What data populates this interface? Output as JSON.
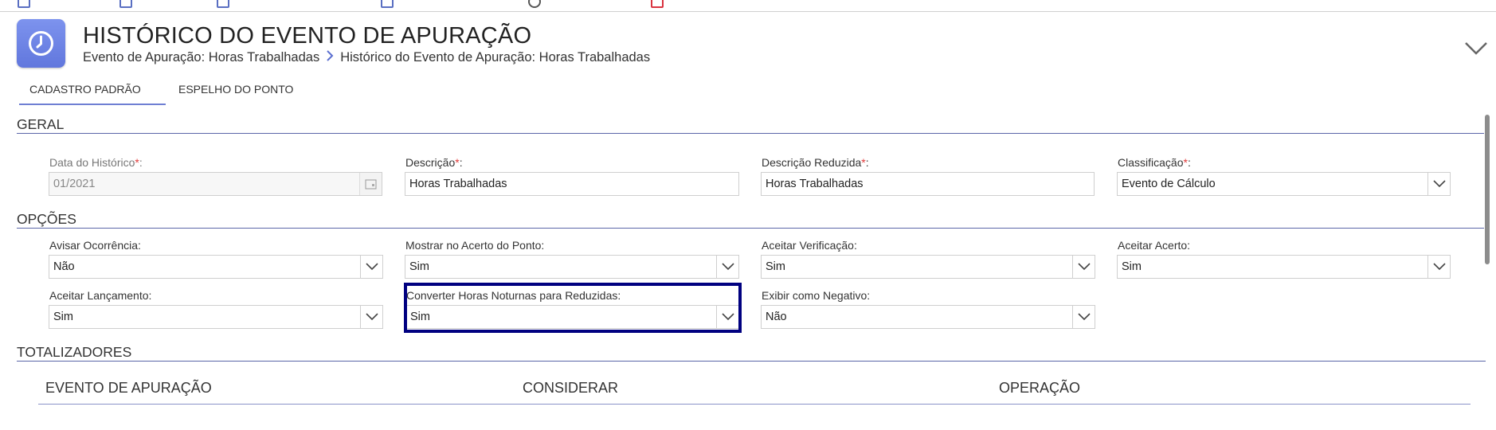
{
  "header": {
    "title": "HISTÓRICO DO EVENTO DE APURAÇÃO",
    "breadcrumb": [
      "Evento de Apuração: Horas Trabalhadas",
      "Histórico do Evento de Apuração: Horas Trabalhadas"
    ]
  },
  "tabs": [
    {
      "label": "CADASTRO PADRÃO",
      "active": true
    },
    {
      "label": "ESPELHO DO PONTO",
      "active": false
    }
  ],
  "geral": {
    "title": "GERAL",
    "data_historico": {
      "label": "Data do Histórico",
      "value": "01/2021",
      "required_mark": "*",
      "suffix": ":"
    },
    "descricao": {
      "label": "Descrição",
      "value": "Horas Trabalhadas",
      "required_mark": "*",
      "suffix": ":"
    },
    "descricao_reduzida": {
      "label": "Descrição Reduzida",
      "value": "Horas Trabalhadas",
      "required_mark": "*",
      "suffix": ":"
    },
    "classificacao": {
      "label": "Classificação",
      "value": "Evento de Cálculo",
      "required_mark": "*",
      "suffix": ":"
    }
  },
  "opcoes": {
    "title": "OPÇÕES",
    "avisar_ocorrencia": {
      "label": "Avisar Ocorrência:",
      "value": "Não"
    },
    "mostrar_acerto_ponto": {
      "label": "Mostrar no Acerto do Ponto:",
      "value": "Sim"
    },
    "aceitar_verificacao": {
      "label": "Aceitar Verificação:",
      "value": "Sim"
    },
    "aceitar_acerto": {
      "label": "Aceitar Acerto:",
      "value": "Sim"
    },
    "aceitar_lancamento": {
      "label": "Aceitar Lançamento:",
      "value": "Sim"
    },
    "converter_horas_noturnas": {
      "label": "Converter Horas Noturnas para Reduzidas:",
      "value": "Sim"
    },
    "exibir_negativo": {
      "label": "Exibir como Negativo:",
      "value": "Não"
    }
  },
  "totalizadores": {
    "title": "TOTALIZADORES",
    "columns": [
      "EVENTO DE APURAÇÃO",
      "CONSIDERAR",
      "OPERAÇÃO"
    ]
  },
  "colors": {
    "accent": "#6f7fd3",
    "highlight_border": "#000080",
    "required": "#e03a3a",
    "app_icon": "#6f84e6"
  },
  "icons": [
    "clock-icon",
    "chevron-right-icon",
    "chevron-down-icon",
    "calendar-icon"
  ]
}
